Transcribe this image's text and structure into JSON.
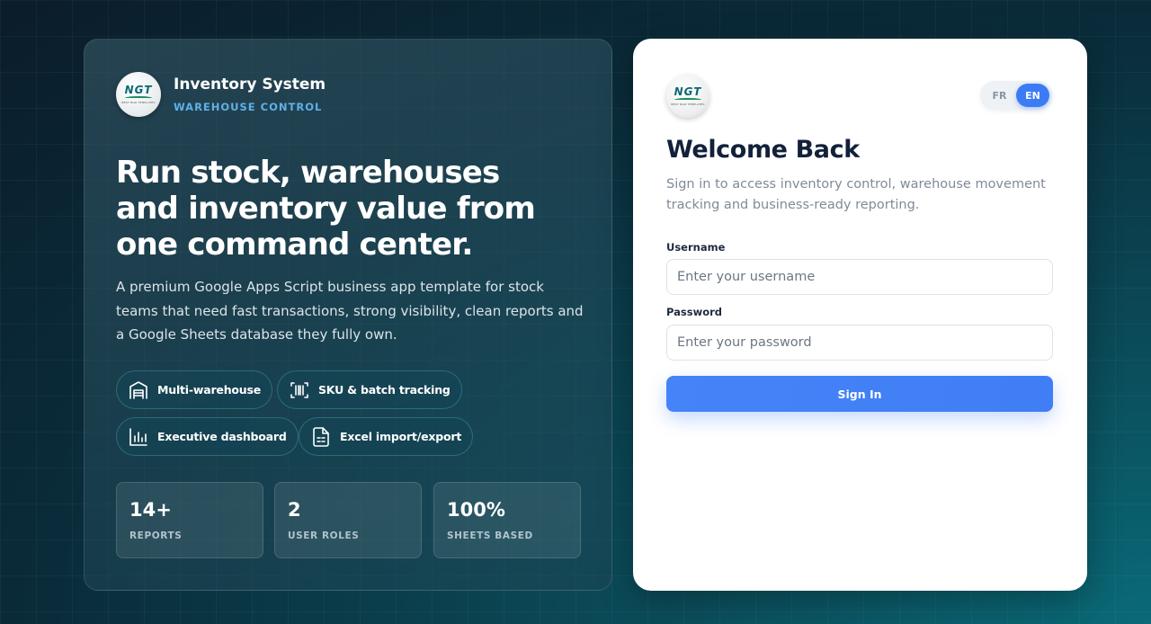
{
  "brand": {
    "logo_text": "NGT",
    "logo_subtext": "BEST NGR TEMPLATES",
    "title": "Inventory System",
    "subtitle": "WAREHOUSE CONTROL"
  },
  "hero": {
    "headline_line1": "Run stock, warehouses",
    "headline_line2": "and inventory value from",
    "headline_line3": "one command center.",
    "description": "A premium Google Apps Script business app template for stock teams that need fast transactions, strong visibility, clean reports and a Google Sheets database they fully own."
  },
  "features": [
    {
      "label": "Multi-warehouse",
      "icon": "warehouse-icon"
    },
    {
      "label": "SKU & batch tracking",
      "icon": "barcode-icon"
    },
    {
      "label": "Executive dashboard",
      "icon": "bar-chart-icon"
    },
    {
      "label": "Excel import/export",
      "icon": "spreadsheet-file-icon"
    }
  ],
  "stats": [
    {
      "value": "14+",
      "label": "REPORTS"
    },
    {
      "value": "2",
      "label": "USER ROLES"
    },
    {
      "value": "100%",
      "label": "SHEETS BASED"
    }
  ],
  "login": {
    "lang_fr": "FR",
    "lang_en": "EN",
    "active_lang": "EN",
    "title": "Welcome Back",
    "subtitle": "Sign in to access inventory control, warehouse movement tracking and business-ready reporting.",
    "username_label": "Username",
    "username_placeholder": "Enter your username",
    "password_label": "Password",
    "password_placeholder": "Enter your password",
    "signin_label": "Sign In"
  },
  "colors": {
    "accent": "#3b7cf6",
    "brand_subtitle": "#5fb0e8",
    "heading_dark": "#13203a"
  }
}
